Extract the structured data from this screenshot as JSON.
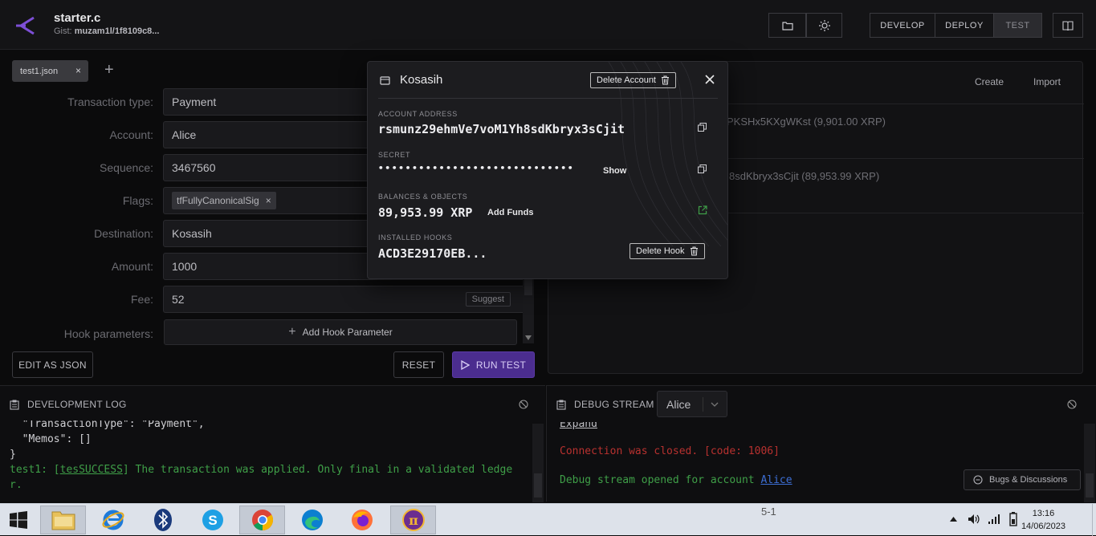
{
  "header": {
    "title": "starter.c",
    "gist_label": "Gist:",
    "gist_value": "muzam1l/1f8109c8...",
    "nav": {
      "develop": "DEVELOP",
      "deploy": "DEPLOY",
      "test": "TEST"
    }
  },
  "editor": {
    "tab_label": "test1.json",
    "tab_close": "×",
    "add_tab": "+"
  },
  "form": {
    "transaction_type_label": "Transaction type:",
    "transaction_type_value": "Payment",
    "account_label": "Account:",
    "account_value": "Alice",
    "sequence_label": "Sequence:",
    "sequence_value": "3467560",
    "flags_label": "Flags:",
    "flag_chip": "tfFullyCanonicalSig",
    "flag_chip_remove": "×",
    "destination_label": "Destination:",
    "destination_value": "Kosasih",
    "amount_label": "Amount:",
    "amount_value": "1000",
    "fee_label": "Fee:",
    "fee_value": "52",
    "suggest_label": "Suggest",
    "hook_params_label": "Hook parameters:",
    "add_hook_param": "Add Hook Parameter",
    "edit_as_json": "EDIT AS JSON",
    "reset": "RESET",
    "run_test": "RUN TEST"
  },
  "accounts_panel": {
    "create": "Create",
    "import": "Import",
    "rows": [
      {
        "text": "PKSHx5KXgWKst (9,901.00 XRP)"
      },
      {
        "text": "8sdKbryx3sCjit (89,953.99 XRP)"
      }
    ]
  },
  "modal": {
    "title": "Kosasih",
    "delete_account": "Delete Account",
    "account_address_label": "ACCOUNT ADDRESS",
    "account_address": "rsmunz29ehmVe7voM1Yh8sdKbryx3sCjit",
    "secret_label": "SECRET",
    "secret_mask": "•••••••••••••••••••••••••••••",
    "show": "Show",
    "balances_label": "BALANCES & OBJECTS",
    "balance": "89,953.99 XRP",
    "add_funds": "Add Funds",
    "installed_hooks_label": "INSTALLED HOOKS",
    "hook_hash": "ACD3E29170EB...",
    "delete_hook": "Delete Hook"
  },
  "dev_log": {
    "title": "DEVELOPMENT LOG",
    "lines": [
      "  \"TransactionType\": \"Payment\",",
      "  \"Memos\": []",
      "}"
    ],
    "result_prefix": "test1: [",
    "result_code": "tesSUCCESS",
    "result_text": "] The transaction was applied. Only final in a validated ledge",
    "result_wrap": "r."
  },
  "debug_stream": {
    "title": "DEBUG STREAM",
    "account_select": "Alice",
    "expand": "Expand",
    "closed_msg": "Connection was closed. [code: 1006]",
    "opened_msg": "Debug stream opened for account ",
    "opened_account": "Alice",
    "bugs_button": "Bugs & Discussions"
  },
  "taskbar": {
    "time": "13:16",
    "date": "14/06/2023",
    "stray_text": "5-1"
  },
  "colors": {
    "accent": "#4b2d8f",
    "success": "#3f9f48",
    "error": "#b8312f",
    "link": "#3d6fd6"
  }
}
